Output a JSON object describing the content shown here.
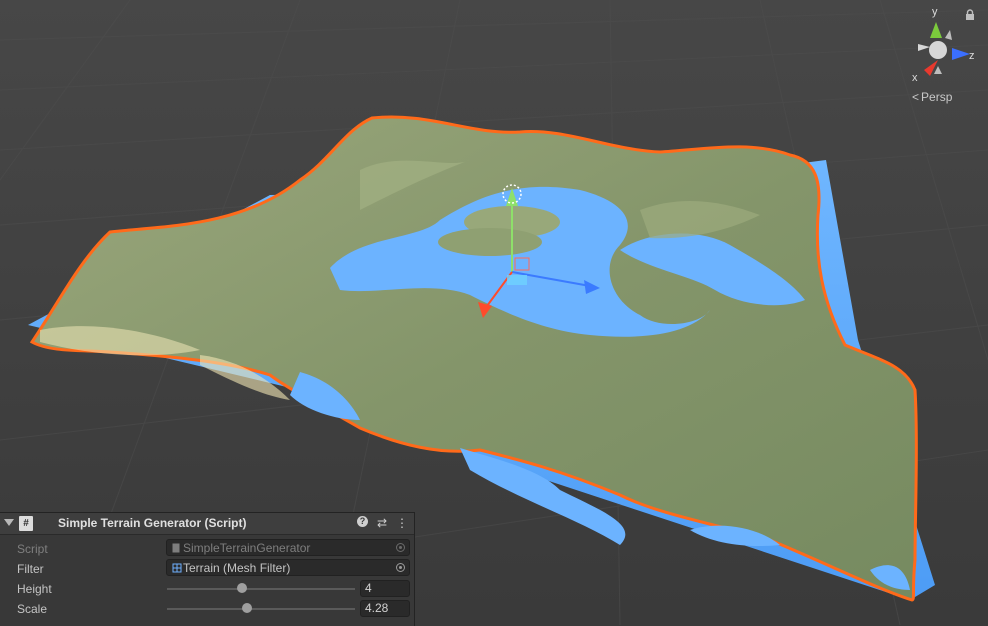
{
  "scene_view": {
    "projection_label": "Persp",
    "axes": {
      "x": "x",
      "y": "y",
      "z": "z"
    }
  },
  "inspector": {
    "component_title": "Simple Terrain Generator (Script)",
    "script_icon_glyph": "#",
    "fields": [
      {
        "label": "Script",
        "value": "SimpleTerrainGenerator",
        "disabled": true
      },
      {
        "label": "Filter",
        "value": "Terrain (Mesh Filter)",
        "disabled": false
      }
    ],
    "sliders": [
      {
        "label": "Height",
        "value": "4",
        "fraction": 0.4
      },
      {
        "label": "Scale",
        "value": "4.28",
        "fraction": 0.428
      }
    ]
  },
  "colors": {
    "terrain": "#8b9a6d",
    "water": "#5aa8ff",
    "selection_outline": "#ff6a1a",
    "background": "#3a3a3a"
  }
}
